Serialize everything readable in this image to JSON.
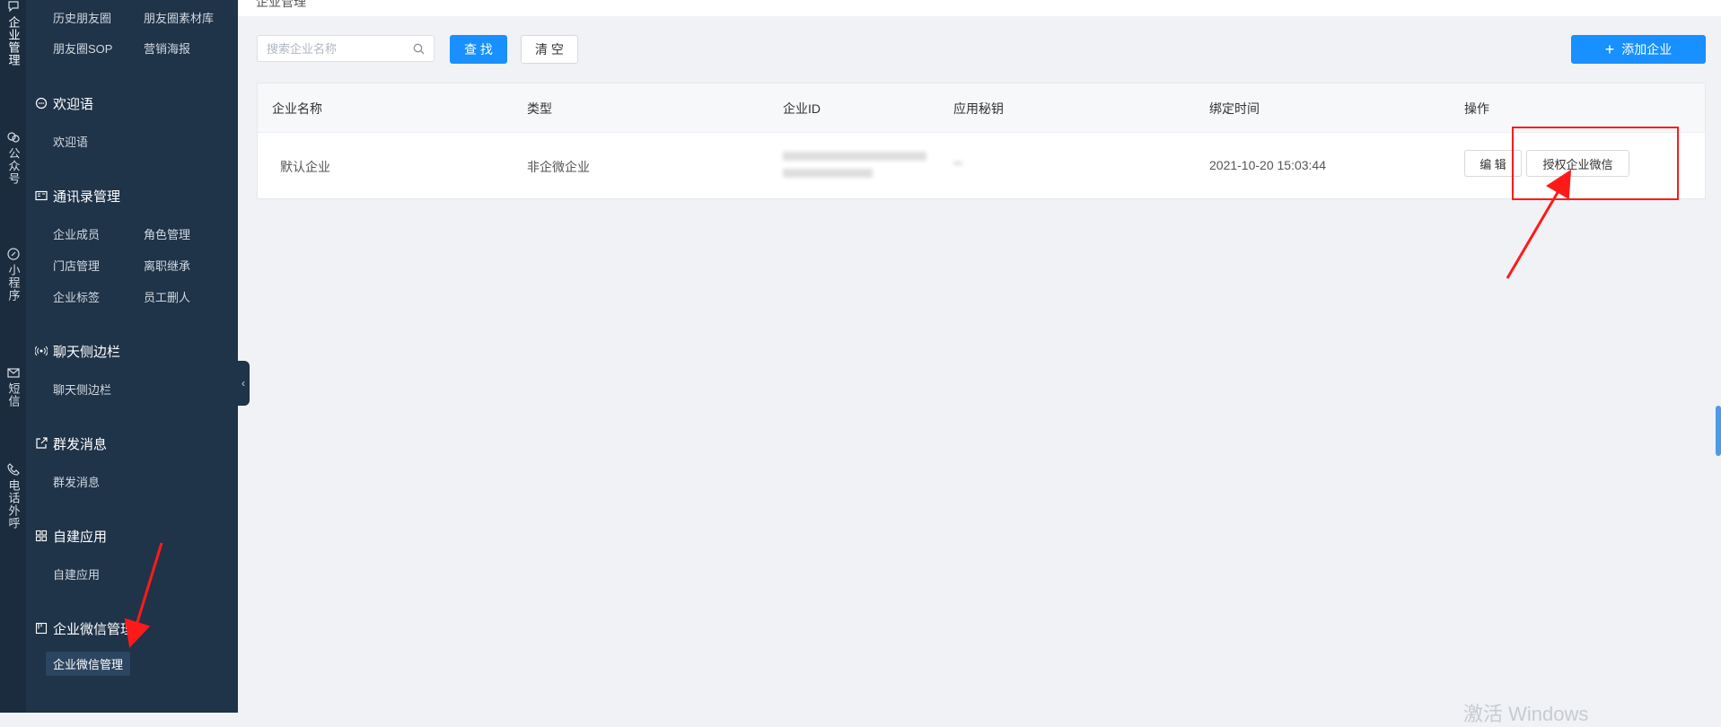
{
  "rail": {
    "items": [
      {
        "label": "企业管理",
        "icon": "chat-icon"
      },
      {
        "label": "公众号",
        "icon": "wechat-icon"
      },
      {
        "label": "小程序",
        "icon": "link-icon"
      },
      {
        "label": "短信",
        "icon": "mail-icon"
      },
      {
        "label": "电话外呼",
        "icon": "phone-icon"
      }
    ]
  },
  "sidebar": {
    "top_links": [
      "历史朋友圈",
      "朋友圈素材库",
      "朋友圈SOP",
      "营销海报"
    ],
    "groups": [
      {
        "title": "欢迎语",
        "icon": "chat-bubble-icon",
        "links": [
          "欢迎语"
        ]
      },
      {
        "title": "通讯录管理",
        "icon": "contact-card-icon",
        "links": [
          "企业成员",
          "角色管理",
          "门店管理",
          "离职继承",
          "企业标签",
          "员工删人"
        ]
      },
      {
        "title": "聊天侧边栏",
        "icon": "broadcast-icon",
        "links": [
          "聊天侧边栏"
        ]
      },
      {
        "title": "群发消息",
        "icon": "send-icon",
        "links": [
          "群发消息"
        ]
      },
      {
        "title": "自建应用",
        "icon": "grid-icon",
        "links": [
          "自建应用"
        ]
      },
      {
        "title": "企业微信管理",
        "icon": "panel-icon",
        "links": [
          "企业微信管理"
        ]
      }
    ]
  },
  "topbar": {
    "breadcrumb": "企业管理"
  },
  "toolbar": {
    "search_placeholder": "搜索企业名称",
    "search_label": "查 找",
    "clear_label": "清 空",
    "add_label": "添加企业"
  },
  "table": {
    "columns": [
      "企业名称",
      "类型",
      "企业ID",
      "应用秘钥",
      "绑定时间",
      "操作"
    ],
    "rows": [
      {
        "name": "默认企业",
        "type": "非企微企业",
        "corp_id": "",
        "secret": "",
        "bind_time": "2021-10-20 15:03:44",
        "actions": [
          "编 辑",
          "授权企业微信"
        ]
      }
    ]
  },
  "watermark": "激活 Windows",
  "colors": {
    "primary": "#1890ff",
    "sidebar_bg": "#1f3349",
    "rail_bg": "#1b2c3f",
    "annotation_red": "#ff1a1a"
  }
}
